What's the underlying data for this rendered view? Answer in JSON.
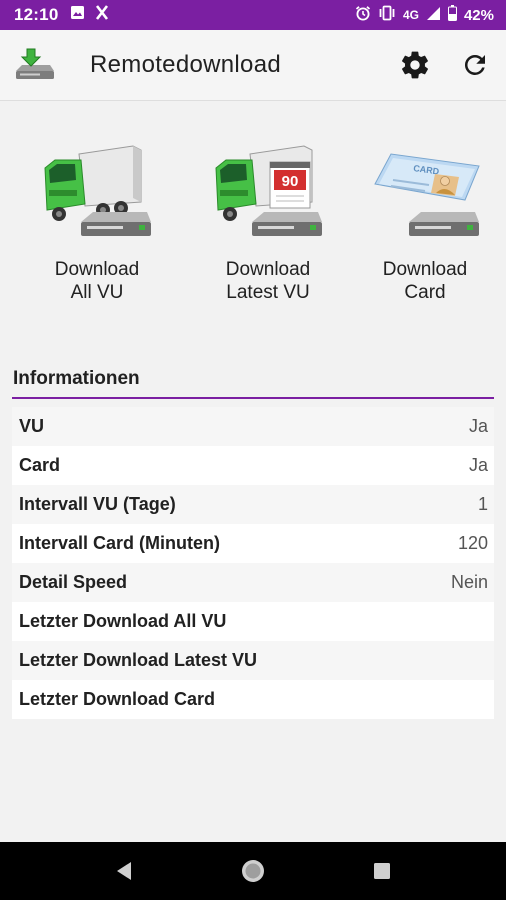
{
  "status_bar": {
    "time": "12:10",
    "network": "4G",
    "battery": "42%",
    "icons": [
      "image-icon",
      "x-icon",
      "alarm-icon",
      "vibrate-icon",
      "signal-icon",
      "battery-icon"
    ]
  },
  "app_bar": {
    "title": "Remotedownload",
    "actions": [
      "settings-icon",
      "refresh-icon"
    ]
  },
  "tiles": [
    {
      "line1": "Download",
      "line2": "All VU",
      "icon": "truck-download-icon"
    },
    {
      "line1": "Download",
      "line2": "Latest VU",
      "icon": "truck-calendar-download-icon",
      "badge": "90"
    },
    {
      "line1": "Download",
      "line2": "Card",
      "icon": "card-download-icon",
      "card_text": "CARD"
    }
  ],
  "info": {
    "title": "Informationen",
    "rows": [
      {
        "label": "VU",
        "value": "Ja"
      },
      {
        "label": "Card",
        "value": "Ja"
      },
      {
        "label": "Intervall VU (Tage)",
        "value": "1"
      },
      {
        "label": "Intervall Card (Minuten)",
        "value": "120"
      },
      {
        "label": "Detail Speed",
        "value": "Nein"
      },
      {
        "label": "Letzter Download All VU",
        "value": ""
      },
      {
        "label": "Letzter Download Latest VU",
        "value": ""
      },
      {
        "label": "Letzter Download Card",
        "value": ""
      }
    ]
  },
  "nav_bar": {
    "buttons": [
      "back-icon",
      "home-icon",
      "recents-icon"
    ]
  },
  "colors": {
    "accent": "#7b1fa2",
    "truck_green": "#3fb33f",
    "background": "#f2f2f2"
  }
}
